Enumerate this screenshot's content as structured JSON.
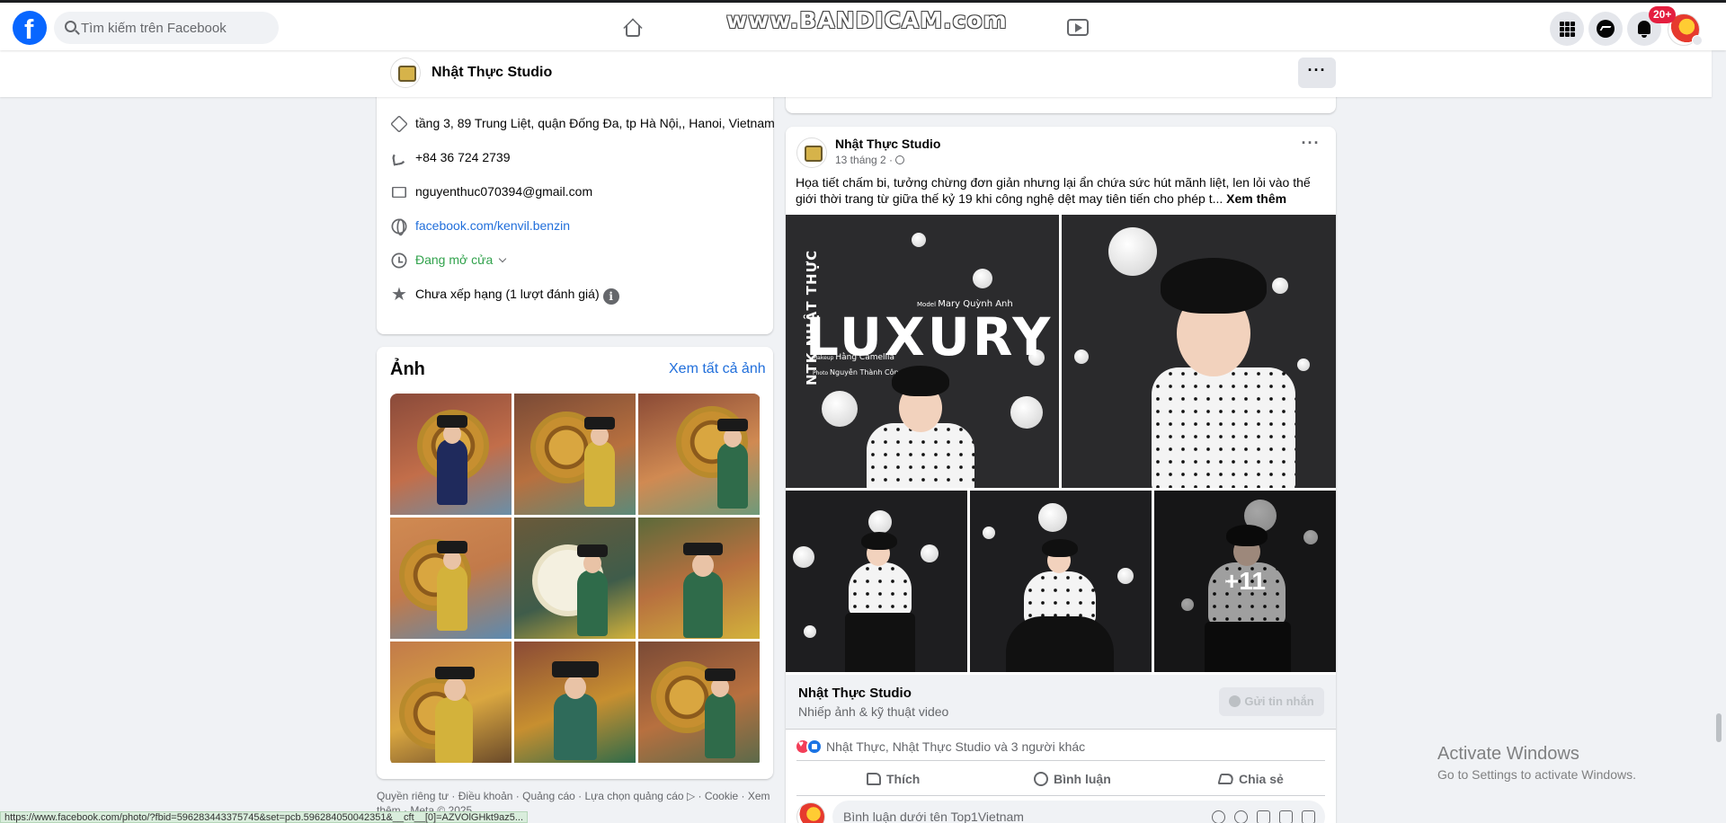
{
  "topnav": {
    "logo_letter": "f",
    "search_placeholder": "Tìm kiếm trên Facebook",
    "watermark": "www.BANDICAM.com",
    "notifications_badge": "20+"
  },
  "page_header": {
    "name": "Nhật Thực Studio",
    "more_label": "···"
  },
  "intro": {
    "address": "tầng 3, 89 Trung Liệt, quận Đống Đa, tp Hà Nội,, Hanoi, Vietnam",
    "phone": "+84 36 724 2739",
    "email": "nguyenthuc070394@gmail.com",
    "website": "facebook.com/kenvil.benzin",
    "hours": "Đang mở cửa",
    "rating": "Chưa xếp hạng (1 lượt đánh giá)",
    "info_glyph": "i",
    "star_glyph": "★"
  },
  "photos": {
    "title": "Ảnh",
    "see_all": "Xem tất cả ảnh"
  },
  "footer": {
    "links": "Quyền riêng tư · Điều khoản · Quảng cáo · Lựa chọn quảng cáo ▷ · Cookie · Xem thêm · Meta © 2025"
  },
  "post": {
    "author": "Nhật Thực Studio",
    "date": "13 tháng 2 ·",
    "more_label": "···",
    "text": "Họa tiết chấm bi, tưởng chừng đơn giản nhưng lại ẩn chứa sức hút mãnh liệt, len lỏi vào thế giới thời trang từ giữa thế kỷ 19 khi công nghệ dệt may tiên tiến cho phép t...",
    "see_more": "Xem thêm",
    "poster": {
      "ntk": "NTK NHẬT THỰC",
      "luxury": "LUXURY",
      "model_label": "Model",
      "model_name": "Mary Quỳnh Anh",
      "makeup_label": "Makeup",
      "makeup_name": "Hằng Camellia",
      "photo_label": "Photo",
      "photo_name": "Nguyễn Thành Công"
    },
    "extra_photos": "+11",
    "page_card": {
      "name": "Nhật Thực Studio",
      "category": "Nhiếp ảnh & kỹ thuật video",
      "message_button": "Gửi tin nhắn"
    },
    "reactions_text": "Nhật Thực, Nhật Thực Studio và 3 người khác",
    "actions": {
      "like": "Thích",
      "comment": "Bình luận",
      "share": "Chia sẻ"
    },
    "comment_placeholder": "Bình luận dưới tên Top1Vietnam"
  },
  "windows": {
    "activate_title": "Activate Windows",
    "activate_sub": "Go to Settings to activate Windows."
  },
  "status_bar": {
    "url": "https://www.facebook.com/photo/?fbid=596283443375745&set=pcb.596284050042351&__cft__[0]=AZVOlGHkt9az5..."
  },
  "colors": {
    "brand": "#0866ff",
    "link": "#216fdb",
    "open_status": "#31a24c",
    "badge": "#e41e3f"
  }
}
